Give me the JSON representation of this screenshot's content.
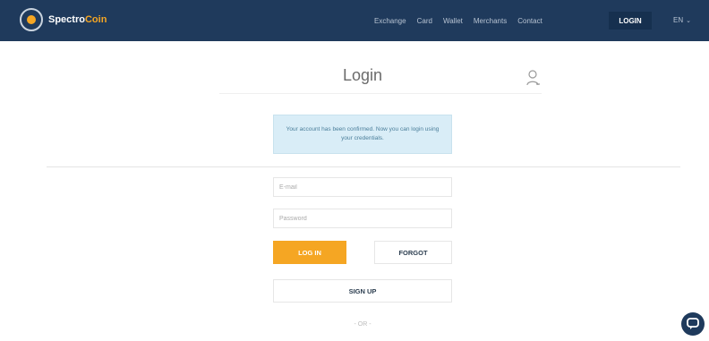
{
  "brand": {
    "name_part1": "Spectro",
    "name_part2": "Coin",
    "accent_color": "#f5a623",
    "nav_color": "#1f3a5c"
  },
  "nav": {
    "links": [
      {
        "label": "Exchange"
      },
      {
        "label": "Card"
      },
      {
        "label": "Wallet"
      },
      {
        "label": "Merchants"
      },
      {
        "label": "Contact"
      }
    ],
    "login_label": "LOGIN",
    "language": "EN"
  },
  "login": {
    "title": "Login",
    "alert": "Your account has been confirmed. Now you can login using your credentials.",
    "email_placeholder": "E-mail",
    "password_placeholder": "Password",
    "login_button": "LOG IN",
    "forgot_button": "FORGOT",
    "signup_button": "SIGN UP",
    "or_text": "- OR -"
  },
  "icons": {
    "user": "user-icon",
    "chat": "chat-icon",
    "logo": "logo-icon"
  }
}
